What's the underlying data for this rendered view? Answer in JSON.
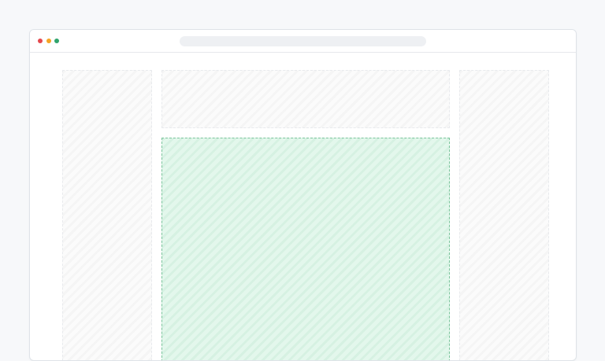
{
  "window": {
    "controls": [
      {
        "name": "close",
        "color": "#e5484d"
      },
      {
        "name": "minimize",
        "color": "#f5a524"
      },
      {
        "name": "maximize",
        "color": "#30a46c"
      }
    ],
    "address_bar": {
      "text": ""
    }
  },
  "layout_blocks": {
    "left_sidebar": {
      "state": "placeholder",
      "color": "#fbfbfb"
    },
    "top_block": {
      "state": "placeholder",
      "color": "#fbfbfb"
    },
    "right_sidebar": {
      "state": "placeholder",
      "color": "#fbfbfb"
    },
    "main_content": {
      "state": "highlighted",
      "color": "#e3f7ec",
      "border_color": "#7ac49b"
    }
  }
}
